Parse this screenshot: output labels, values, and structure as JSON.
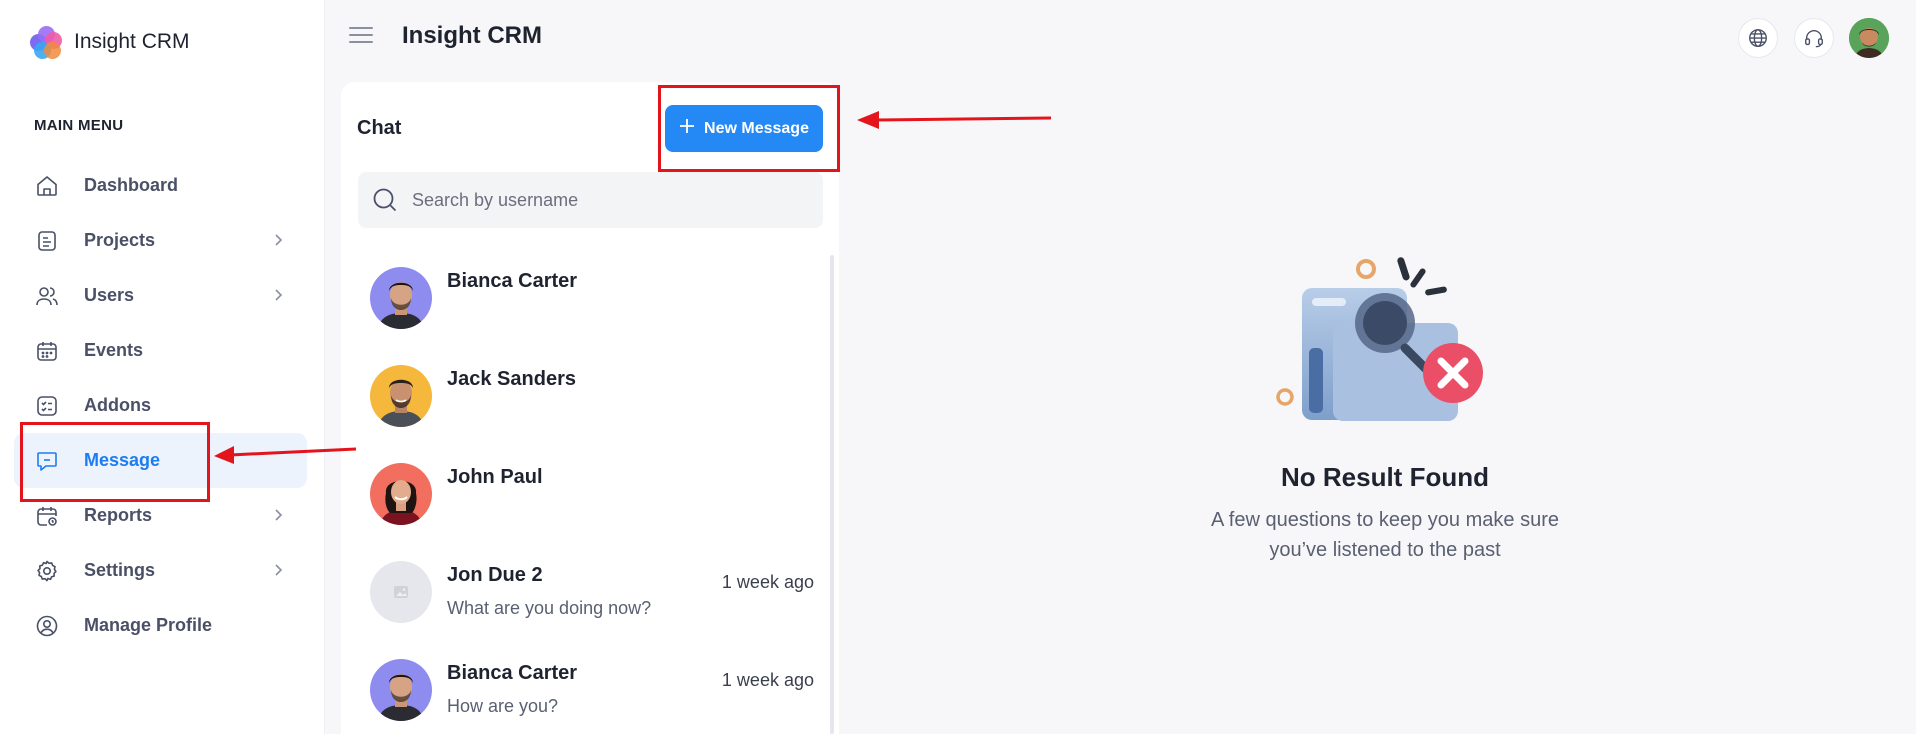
{
  "brand": {
    "name": "Insight CRM"
  },
  "sidebar": {
    "menu_title": "MAIN MENU",
    "items": [
      {
        "label": "Dashboard",
        "icon": "home-icon",
        "chevron": false,
        "active": false
      },
      {
        "label": "Projects",
        "icon": "document-icon",
        "chevron": true,
        "active": false
      },
      {
        "label": "Users",
        "icon": "users-icon",
        "chevron": true,
        "active": false
      },
      {
        "label": "Events",
        "icon": "calendar-icon",
        "chevron": false,
        "active": false
      },
      {
        "label": "Addons",
        "icon": "checklist-icon",
        "chevron": false,
        "active": false
      },
      {
        "label": "Message",
        "icon": "message-icon",
        "chevron": false,
        "active": true
      },
      {
        "label": "Reports",
        "icon": "calendar-report-icon",
        "chevron": true,
        "active": false
      },
      {
        "label": "Settings",
        "icon": "gear-icon",
        "chevron": true,
        "active": false
      },
      {
        "label": "Manage Profile",
        "icon": "user-circle-icon",
        "chevron": false,
        "active": false
      }
    ]
  },
  "header": {
    "title": "Insight CRM",
    "icons": [
      "globe-icon",
      "headset-icon",
      "user-avatar"
    ]
  },
  "chat": {
    "title": "Chat",
    "new_message_label": "New Message",
    "search_placeholder": "Search by username",
    "items": [
      {
        "name": "Bianca Carter",
        "preview": "",
        "time": "",
        "avatar_bg": "#8f8cf0"
      },
      {
        "name": "Jack Sanders",
        "preview": "",
        "time": "",
        "avatar_bg": "#f5b73c"
      },
      {
        "name": "John Paul",
        "preview": "",
        "time": "",
        "avatar_bg": "#f26e5e"
      },
      {
        "name": "Jon Due 2",
        "preview": "What are you doing now?",
        "time": "1 week ago",
        "avatar_bg": "#e6e7ec"
      },
      {
        "name": "Bianca Carter",
        "preview": "How are you?",
        "time": "1 week ago",
        "avatar_bg": "#8f8cf0"
      }
    ]
  },
  "empty_state": {
    "title": "No Result Found",
    "description": "A few questions to keep you make sure you’ve listened to the past"
  },
  "colors": {
    "accent": "#2589f5",
    "active_bg": "#edf3fd",
    "annotation": "#e3141b"
  }
}
